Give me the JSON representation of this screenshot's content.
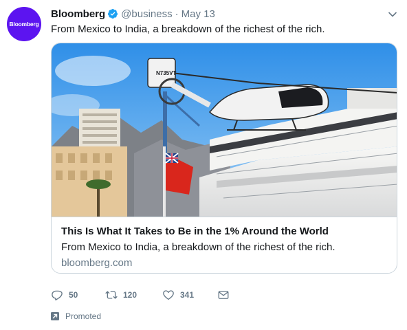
{
  "tweet": {
    "avatar_text": "Bloomberg",
    "author_name": "Bloomberg",
    "handle": "@business",
    "separator": "·",
    "date": "May 13",
    "text": "From Mexico to India, a breakdown of the richest of the rich.",
    "verified": true
  },
  "card": {
    "title": "This Is What It Takes to Be in the 1% Around the World",
    "description": "From Mexico to India, a breakdown of the richest of the rich.",
    "domain": "bloomberg.com",
    "image": {
      "helicopter_registration": "N735VT"
    }
  },
  "actions": {
    "reply_count": "50",
    "retweet_count": "120",
    "like_count": "341"
  },
  "promoted_label": "Promoted",
  "icons": [
    "verified-icon",
    "caret-down-icon",
    "reply-icon",
    "retweet-icon",
    "like-icon",
    "dm-icon",
    "promoted-icon"
  ],
  "colors": {
    "brand": "#5c14f0",
    "verified": "#1da1f2",
    "secondary_text": "#657786",
    "border": "#ccd6dd"
  }
}
